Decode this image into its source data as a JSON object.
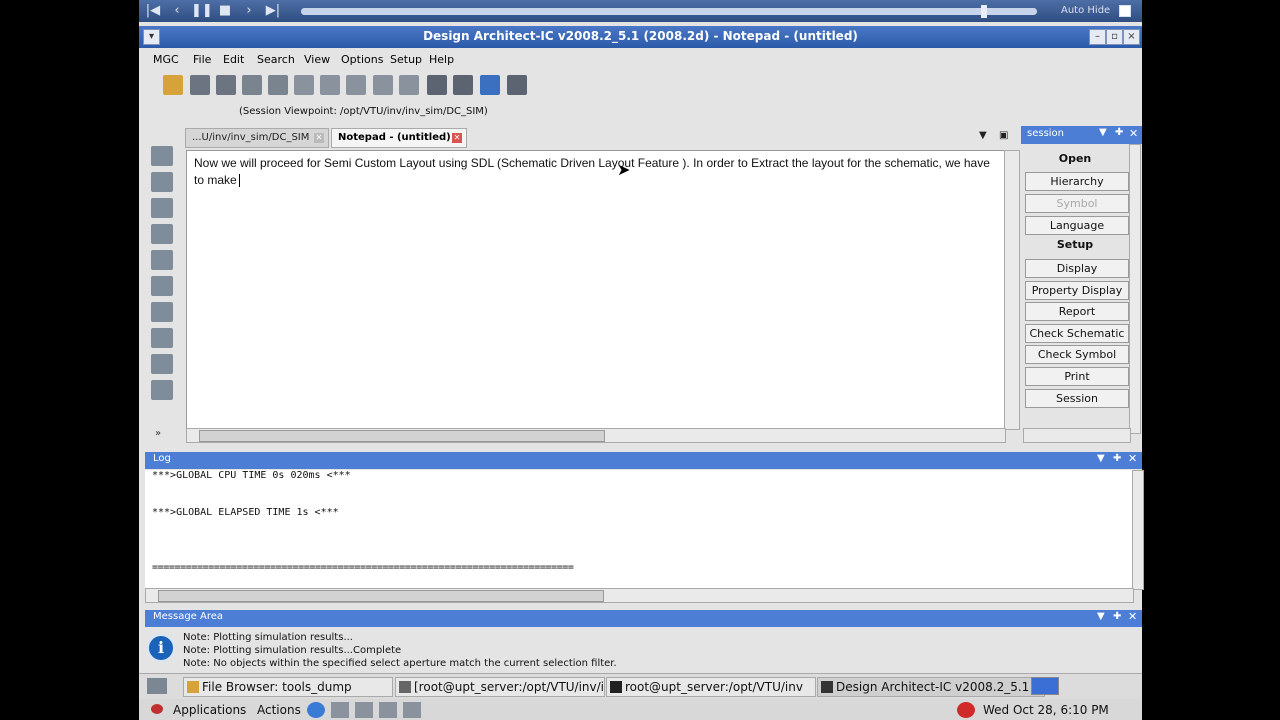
{
  "player": {
    "auto_hide": "Auto Hide"
  },
  "window": {
    "title": "Design Architect-IC v2008.2_5.1  (2008.2d)  - Notepad - (untitled)"
  },
  "menu": [
    "MGC",
    "File",
    "Edit",
    "Search",
    "View",
    "Options",
    "Setup",
    "Help"
  ],
  "viewpoint": "(Session Viewpoint: /opt/VTU/inv/inv_sim/DC_SIM)",
  "tabs": [
    {
      "label": "...U/inv/inv_sim/DC_SIM"
    },
    {
      "label": "Notepad - (untitled)"
    }
  ],
  "editor": {
    "text": "Now we will proceed for Semi Custom Layout using SDL (Schematic Driven Layout Feature ). In order to Extract the layout for the schematic, we have to make"
  },
  "session": {
    "title": "session",
    "open_label": "Open",
    "setup_label": "Setup",
    "open_buttons": [
      "Hierarchy",
      "Symbol",
      "Language"
    ],
    "setup_buttons": [
      "Display",
      "Property Display",
      "Report",
      "Check Schematic",
      "Check Symbol",
      "Print",
      "Session"
    ]
  },
  "log": {
    "title": "Log",
    "lines": [
      "***>GLOBAL CPU TIME 0s 020ms <***",
      "***>GLOBAL ELAPSED TIME 1s <***",
      "==========================================================================="
    ]
  },
  "message_area": {
    "title": "Message Area",
    "lines": [
      "Note: Plotting simulation results...",
      "Note: Plotting simulation results...Complete",
      "Note: No objects within the specified select aperture match the current selection filter."
    ]
  },
  "taskbar": [
    "File Browser: tools_dump",
    "[root@upt_server:/opt/VTU/inv/ir",
    "root@upt_server:/opt/VTU/inv",
    "Design Architect-IC v2008.2_5.1"
  ],
  "bottom_panel": {
    "applications": "Applications",
    "actions": "Actions",
    "clock": "Wed Oct 28,  6:10 PM"
  }
}
